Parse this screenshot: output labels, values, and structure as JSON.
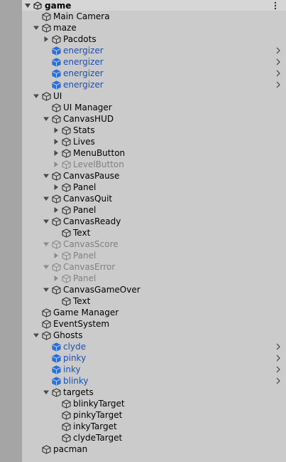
{
  "scene": {
    "name": "game",
    "menu_icon": "kebab-menu-icon",
    "collapse_icon": "fold-open-icon",
    "scene_icon": "unity-scene-icon"
  },
  "colors": {
    "prefab_text": "#1b4fb0",
    "inactive_text": "#808080",
    "prefab_cube": "#2d6fd6",
    "normal_cube": "#3a3a3a"
  },
  "hierarchy": [
    {
      "label": "Main Camera",
      "depth": 0,
      "fold": "none",
      "type": "object"
    },
    {
      "label": "maze",
      "depth": 0,
      "fold": "open",
      "type": "object"
    },
    {
      "label": "Pacdots",
      "depth": 1,
      "fold": "closed",
      "type": "object"
    },
    {
      "label": "energizer",
      "depth": 1,
      "fold": "none",
      "type": "prefab"
    },
    {
      "label": "energizer",
      "depth": 1,
      "fold": "none",
      "type": "prefab"
    },
    {
      "label": "energizer",
      "depth": 1,
      "fold": "none",
      "type": "prefab"
    },
    {
      "label": "energizer",
      "depth": 1,
      "fold": "none",
      "type": "prefab"
    },
    {
      "label": "UI",
      "depth": 0,
      "fold": "open",
      "type": "object"
    },
    {
      "label": "UI Manager",
      "depth": 1,
      "fold": "none",
      "type": "object"
    },
    {
      "label": "CanvasHUD",
      "depth": 1,
      "fold": "open",
      "type": "object"
    },
    {
      "label": "Stats",
      "depth": 2,
      "fold": "closed",
      "type": "object"
    },
    {
      "label": "Lives",
      "depth": 2,
      "fold": "closed",
      "type": "object"
    },
    {
      "label": "MenuButton",
      "depth": 2,
      "fold": "closed",
      "type": "object"
    },
    {
      "label": "LevelButton",
      "depth": 2,
      "fold": "closed",
      "type": "inactive"
    },
    {
      "label": "CanvasPause",
      "depth": 1,
      "fold": "open",
      "type": "object"
    },
    {
      "label": "Panel",
      "depth": 2,
      "fold": "closed",
      "type": "object"
    },
    {
      "label": "CanvasQuit",
      "depth": 1,
      "fold": "open",
      "type": "object"
    },
    {
      "label": "Panel",
      "depth": 2,
      "fold": "closed",
      "type": "object"
    },
    {
      "label": "CanvasReady",
      "depth": 1,
      "fold": "open",
      "type": "object"
    },
    {
      "label": "Text",
      "depth": 2,
      "fold": "none",
      "type": "object"
    },
    {
      "label": "CanvasScore",
      "depth": 1,
      "fold": "open",
      "type": "inactive"
    },
    {
      "label": "Panel",
      "depth": 2,
      "fold": "closed",
      "type": "inactive"
    },
    {
      "label": "CanvasError",
      "depth": 1,
      "fold": "open",
      "type": "inactive"
    },
    {
      "label": "Panel",
      "depth": 2,
      "fold": "closed",
      "type": "inactive"
    },
    {
      "label": "CanvasGameOver",
      "depth": 1,
      "fold": "open",
      "type": "object"
    },
    {
      "label": "Text",
      "depth": 2,
      "fold": "none",
      "type": "object"
    },
    {
      "label": "Game Manager",
      "depth": 0,
      "fold": "none",
      "type": "object"
    },
    {
      "label": "EventSystem",
      "depth": 0,
      "fold": "none",
      "type": "object"
    },
    {
      "label": "Ghosts",
      "depth": 0,
      "fold": "open",
      "type": "object"
    },
    {
      "label": "clyde",
      "depth": 1,
      "fold": "none",
      "type": "prefab"
    },
    {
      "label": "pinky",
      "depth": 1,
      "fold": "none",
      "type": "prefab"
    },
    {
      "label": "inky",
      "depth": 1,
      "fold": "none",
      "type": "prefab"
    },
    {
      "label": "blinky",
      "depth": 1,
      "fold": "none",
      "type": "prefab"
    },
    {
      "label": "targets",
      "depth": 1,
      "fold": "open",
      "type": "object"
    },
    {
      "label": "blinkyTarget",
      "depth": 2,
      "fold": "none",
      "type": "object"
    },
    {
      "label": "pinkyTarget",
      "depth": 2,
      "fold": "none",
      "type": "object"
    },
    {
      "label": "inkyTarget",
      "depth": 2,
      "fold": "none",
      "type": "object"
    },
    {
      "label": "clydeTarget",
      "depth": 2,
      "fold": "none",
      "type": "object"
    },
    {
      "label": "pacman",
      "depth": 0,
      "fold": "none",
      "type": "object"
    }
  ]
}
